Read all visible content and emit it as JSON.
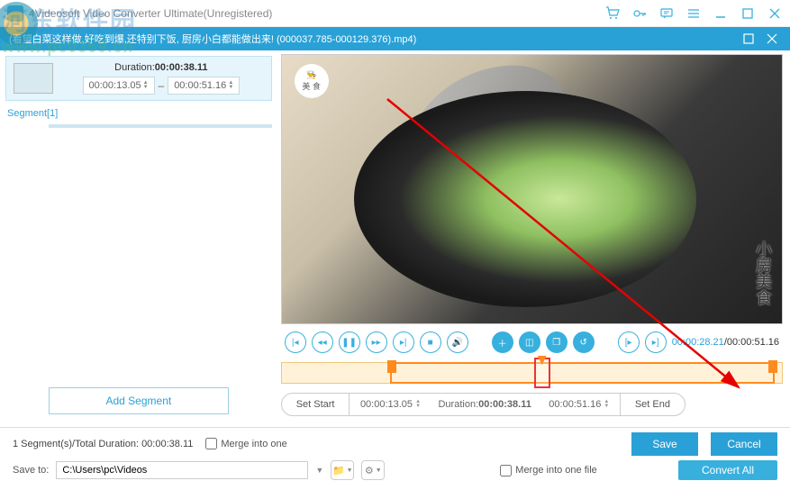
{
  "titlebar": {
    "title": "4Videosoft Video Converter Ultimate(Unregistered)"
  },
  "subheader": {
    "filename": "(看望白菜这样做,好吃到爆,还特别下饭, 厨房小白都能做出来! (000037.785-000129.376).mp4)"
  },
  "segment": {
    "duration_label": "Duration:",
    "duration_value": "00:00:38.11",
    "start": "00:00:13.05",
    "end": "00:00:51.16",
    "name": "Segment[1]"
  },
  "add_segment": "Add Segment",
  "preview": {
    "chef_text": "美 食",
    "right_wm": "小房美食"
  },
  "playback": {
    "current": "00:00:28.21",
    "total": "00:00:51.16"
  },
  "trim": {
    "set_start": "Set Start",
    "start_val": "00:00:13.05",
    "duration_label": "Duration:",
    "duration_val": "00:00:38.11",
    "end_val": "00:00:51.16",
    "set_end": "Set End"
  },
  "footer": {
    "summary": "1 Segment(s)/Total Duration: 00:00:38.11",
    "merge": "Merge into one",
    "save": "Save",
    "cancel": "Cancel",
    "save_to": "Save to:",
    "path": "C:\\Users\\pc\\Videos",
    "merge_file": "Merge into one file",
    "convert": "Convert All"
  },
  "watermark": {
    "text": "河东软件园",
    "url": "www.pc0359.cn"
  }
}
